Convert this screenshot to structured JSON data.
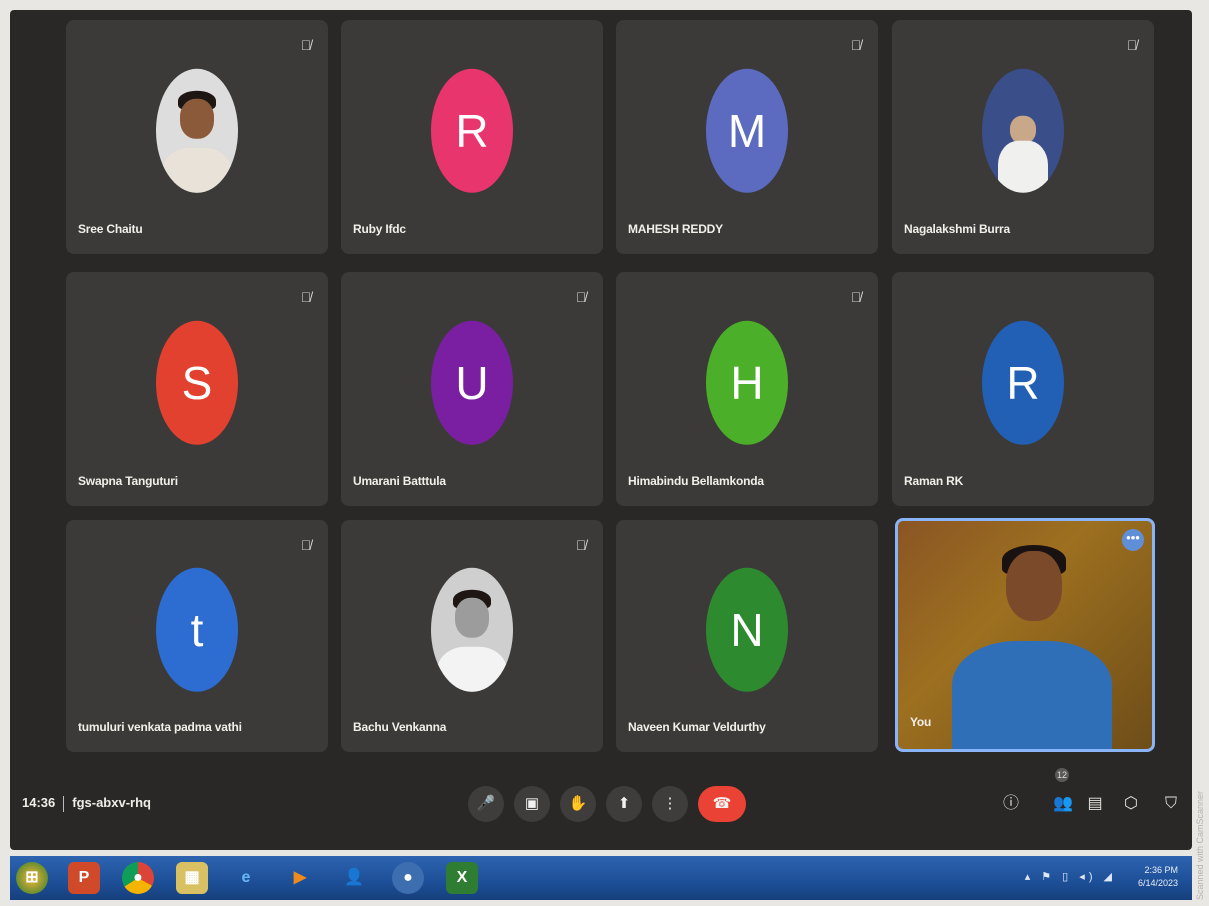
{
  "meeting": {
    "time": "14:36",
    "code": "fgs-abxv-rhq"
  },
  "participants": [
    {
      "name": "Sree Chaitu",
      "initial": "",
      "color": "",
      "muted": true
    },
    {
      "name": "Ruby Ifdc",
      "initial": "R",
      "color": "#e8356e",
      "muted": false
    },
    {
      "name": "MAHESH REDDY",
      "initial": "M",
      "color": "#5c6bc0",
      "muted": true
    },
    {
      "name": "Nagalakshmi Burra",
      "initial": "",
      "color": "",
      "muted": true
    },
    {
      "name": "Swapna Tanguturi",
      "initial": "S",
      "color": "#e3412f",
      "muted": true
    },
    {
      "name": "Umarani Batttula",
      "initial": "U",
      "color": "#7b1fa2",
      "muted": true
    },
    {
      "name": "Himabindu Bellamkonda",
      "initial": "H",
      "color": "#4caf2a",
      "muted": true
    },
    {
      "name": "Raman RK",
      "initial": "R",
      "color": "#2160b5",
      "muted": false
    },
    {
      "name": "tumuluri venkata padma vathi",
      "initial": "t",
      "color": "#2d6cd0",
      "muted": true
    },
    {
      "name": "Bachu Venkanna",
      "initial": "",
      "color": "",
      "muted": true
    },
    {
      "name": "Naveen Kumar Veldurthy",
      "initial": "N",
      "color": "#2e8a2e",
      "muted": false
    },
    {
      "name": "You",
      "initial": "",
      "color": "",
      "muted": false
    }
  ],
  "controls": {
    "mic_icon": "mic-icon",
    "camera_icon": "camera-icon",
    "raise_hand_icon": "hand-icon",
    "present_icon": "present-icon",
    "more_icon": "more-vert-icon",
    "end_call_icon": "end-call-icon"
  },
  "side_badge": "12",
  "taskbar": {
    "clock_time": "2:36 PM",
    "clock_date": "6/14/2023"
  },
  "watermark": "Scanned with CamScanner"
}
